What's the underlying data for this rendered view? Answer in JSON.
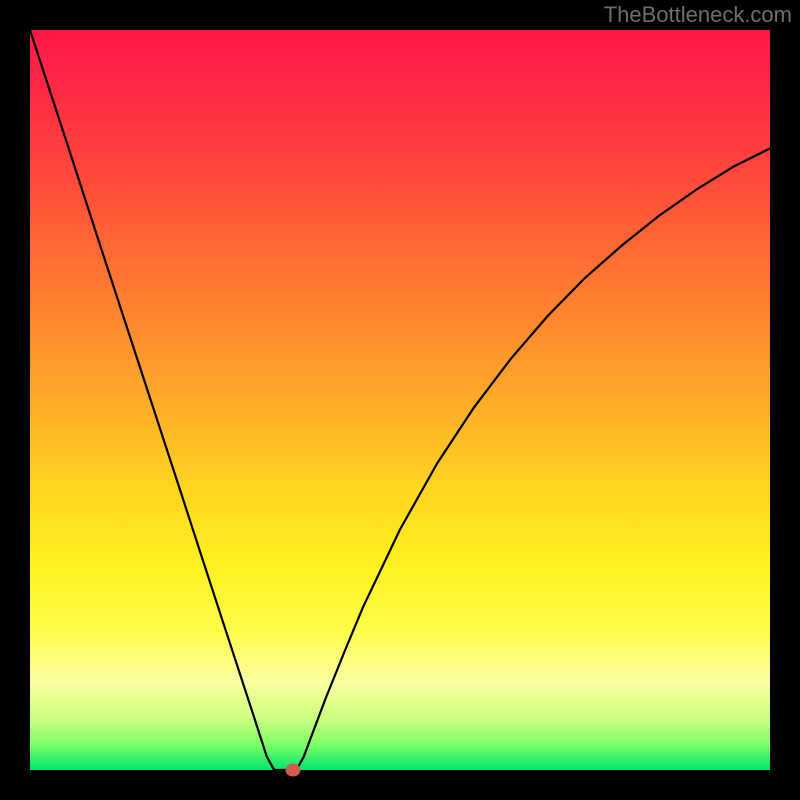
{
  "watermark": {
    "text": "TheBottleneck.com"
  },
  "chart_data": {
    "type": "line",
    "title": "",
    "xlabel": "",
    "ylabel": "",
    "xlim": [
      0,
      100
    ],
    "ylim": [
      0,
      100
    ],
    "series": [
      {
        "name": "curve",
        "x": [
          0,
          5,
          10,
          15,
          20,
          25,
          30,
          32,
          33,
          34,
          36,
          37,
          38,
          40,
          42.5,
          45,
          50,
          55,
          60,
          65,
          70,
          75,
          80,
          85,
          90,
          95,
          100
        ],
        "values": [
          100,
          84.7,
          69.3,
          54.0,
          38.7,
          23.3,
          8.0,
          1.8,
          0,
          0,
          0,
          1.8,
          4.5,
          9.8,
          16.0,
          22.0,
          32.5,
          41.4,
          49.0,
          55.6,
          61.4,
          66.5,
          70.9,
          74.9,
          78.4,
          81.5,
          84.0
        ]
      }
    ],
    "marker": {
      "x": 35.5,
      "y": 0
    },
    "background_gradient": {
      "top": "#ff1846",
      "bottom": "#00e66f"
    }
  }
}
